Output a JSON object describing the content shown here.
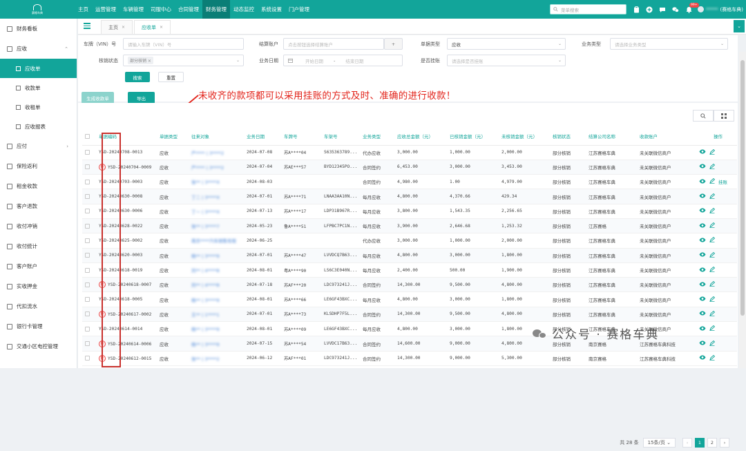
{
  "header": {
    "logo_text": "赛格车典",
    "nav": [
      "主页",
      "运营管理",
      "车辆管理",
      "司服中心",
      "合同管理",
      "财务管理",
      "动态监控",
      "系统设置",
      "门户管理"
    ],
    "active_nav": "财务管理",
    "search_placeholder": "菜单搜索",
    "notif_badge": "99+",
    "username": "(赛格车典)"
  },
  "sidebar": {
    "items": [
      {
        "label": "财务看板",
        "type": "item"
      },
      {
        "label": "应收",
        "type": "group",
        "expanded": true
      },
      {
        "label": "应收单",
        "type": "sub",
        "active": true
      },
      {
        "label": "收款单",
        "type": "sub"
      },
      {
        "label": "收租单",
        "type": "sub"
      },
      {
        "label": "应收报表",
        "type": "sub"
      },
      {
        "label": "应付",
        "type": "group",
        "expanded": false
      },
      {
        "label": "保险返利",
        "type": "item"
      },
      {
        "label": "租金收款",
        "type": "item"
      },
      {
        "label": "客户退款",
        "type": "item"
      },
      {
        "label": "收付冲销",
        "type": "item"
      },
      {
        "label": "收付统计",
        "type": "item"
      },
      {
        "label": "客户账户",
        "type": "item"
      },
      {
        "label": "实收押金",
        "type": "item"
      },
      {
        "label": "代扣流水",
        "type": "item"
      },
      {
        "label": "银行卡管理",
        "type": "item"
      },
      {
        "label": "交通小区电控管理",
        "type": "item"
      }
    ]
  },
  "tabs": [
    {
      "label": "主页",
      "close": "×"
    },
    {
      "label": "应收单",
      "close": "×",
      "active": true
    }
  ],
  "filters": {
    "vin_label": "车牌（VIN）号",
    "vin_placeholder": "请输入车牌（VIN）号",
    "account_label": "结算账户",
    "account_placeholder": "点击按钮选择结算账户",
    "account_btn": "+",
    "doc_type_label": "单据类型",
    "doc_type_value": "应收",
    "biz_type_label": "业务类型",
    "biz_type_placeholder": "请选择业务类型",
    "verify_label": "核销状态",
    "verify_chip": "部分核销",
    "biz_date_label": "业务日期",
    "start_placeholder": "开始日期",
    "date_sep": "-",
    "end_placeholder": "结束日期",
    "hang_label": "是否挂账",
    "hang_placeholder": "请选择是否挂账",
    "search_btn": "搜索",
    "reset_btn": "重置"
  },
  "toolbar": {
    "generate_btn": "生成收款单",
    "export_btn": "导出"
  },
  "annotation": "未收齐的款项都可以采用挂账的方式及时、准确的进行收款！",
  "table": {
    "columns": [
      "单据编码",
      "单据类型",
      "往来对象",
      "业务日期",
      "车牌号",
      "车架号",
      "业务类型",
      "应收总金额（元）",
      "已核销金额（元）",
      "未核销金额（元）",
      "核销状态",
      "结算公司名称",
      "收款账户",
      "操作"
    ],
    "rows": [
      {
        "gua": false,
        "code": "YSD-20240708-0013",
        "type": "应收",
        "party": "严**** | 3****2",
        "date": "2024-07-08",
        "plate": "苏A****04",
        "vin": "S635363789...",
        "biz": "代办应收",
        "total": "3,000.00",
        "done": "1,000.00",
        "undone": "2,000.00",
        "status": "部分核销",
        "company": "江苏赛格车典",
        "account": "未关联微信商户",
        "extra": ""
      },
      {
        "gua": true,
        "code": "YSD-20240704-0009",
        "type": "应收",
        "party": "严**** | 3****2",
        "date": "2024-07-04",
        "plate": "苏AE***57",
        "vin": "BYD12345PO...",
        "biz": "合同签约",
        "total": "6,453.00",
        "done": "3,000.00",
        "undone": "3,453.00",
        "status": "部分核销",
        "company": "江苏赛格车典",
        "account": "未关联微信商户",
        "extra": ""
      },
      {
        "gua": false,
        "code": "YSD-20240703-0003",
        "type": "应收",
        "party": "张** | 3****X",
        "date": "2024-08-03",
        "plate": "",
        "vin": "",
        "biz": "合同签约",
        "total": "4,980.00",
        "done": "1.00",
        "undone": "4,979.00",
        "status": "部分核销",
        "company": "江苏赛格车典",
        "account": "未关联微信商户",
        "extra": "挂账"
      },
      {
        "gua": false,
        "code": "YSD-20240630-0008",
        "type": "应收",
        "party": "丁二 | 3****X",
        "date": "2024-07-01",
        "plate": "苏A****71",
        "vin": "LNAA3AA10N...",
        "biz": "每月应收",
        "total": "4,800.00",
        "done": "4,370.66",
        "undone": "429.34",
        "status": "部分核销",
        "company": "江苏赛格车典",
        "account": "未关联微信商户",
        "extra": ""
      },
      {
        "gua": false,
        "code": "YSD-20240630-0006",
        "type": "应收",
        "party": "丁一 | 3****X",
        "date": "2024-07-13",
        "plate": "苏A****17",
        "vin": "LDP31B967R...",
        "biz": "每月应收",
        "total": "3,800.00",
        "done": "1,543.35",
        "undone": "2,256.65",
        "status": "部分核销",
        "company": "江苏赛格车典",
        "account": "未关联微信商户",
        "extra": ""
      },
      {
        "gua": false,
        "code": "YSD-20240628-0022",
        "type": "应收",
        "party": "张** | 3****7",
        "date": "2024-05-23",
        "plate": "鲁A****51",
        "vin": "LFPBC7PC1N...",
        "biz": "每月应收",
        "total": "3,900.00",
        "done": "2,646.68",
        "undone": "1,253.32",
        "status": "部分核销",
        "company": "江苏赛格",
        "account": "未关联微信商户",
        "extra": ""
      },
      {
        "gua": false,
        "code": "YSD-20240625-0002",
        "type": "应收",
        "party": "南京****汽车销售有限",
        "date": "2024-06-25",
        "plate": "",
        "vin": "",
        "biz": "代办应收",
        "total": "3,000.00",
        "done": "1,000.00",
        "undone": "2,000.00",
        "status": "部分核销",
        "company": "江苏赛格车典",
        "account": "未关联微信商户",
        "extra": ""
      },
      {
        "gua": false,
        "code": "YSD-20240620-0003",
        "type": "应收",
        "party": "杨** | 3****9",
        "date": "2024-07-01",
        "plate": "苏A****47",
        "vin": "LVVDCQ7B63...",
        "biz": "每月应收",
        "total": "4,800.00",
        "done": "3,000.00",
        "undone": "1,800.00",
        "status": "部分核销",
        "company": "江苏赛格车典",
        "account": "未关联微信商户",
        "extra": ""
      },
      {
        "gua": false,
        "code": "YSD-20240618-0019",
        "type": "应收",
        "party": "刘** | 4****8",
        "date": "2024-08-01",
        "plate": "粤A****90",
        "vin": "LS6C3E040N...",
        "biz": "每月应收",
        "total": "2,400.00",
        "done": "500.00",
        "undone": "1,900.00",
        "status": "部分核销",
        "company": "江苏赛格车典",
        "account": "未关联微信商户",
        "extra": ""
      },
      {
        "gua": true,
        "code": "YSD-20240618-0007",
        "type": "应收",
        "party": "刘** | 4****8",
        "date": "2024-07-18",
        "plate": "苏AF***20",
        "vin": "LDC973241J...",
        "biz": "合同签约",
        "total": "14,300.00",
        "done": "9,500.00",
        "undone": "4,800.00",
        "status": "部分核销",
        "company": "江苏赛格车典",
        "account": "未关联微信商户",
        "extra": ""
      },
      {
        "gua": false,
        "code": "YSD-20240618-0005",
        "type": "应收",
        "party": "杨** | 3****9",
        "date": "2024-08-01",
        "plate": "苏A****66",
        "vin": "LE6GF43BXC...",
        "biz": "每月应收",
        "total": "4,800.00",
        "done": "3,000.00",
        "undone": "1,800.00",
        "status": "部分核销",
        "company": "江苏赛格车典",
        "account": "未关联微信商户",
        "extra": ""
      },
      {
        "gua": true,
        "code": "YSD-20240617-0002",
        "type": "应收",
        "party": "王** | 1****1",
        "date": "2024-07-01",
        "plate": "苏A****73",
        "vin": "KLSDHP7F5L...",
        "biz": "合同签约",
        "total": "14,300.00",
        "done": "9,500.00",
        "undone": "4,800.00",
        "status": "部分核销",
        "company": "江苏赛格车典",
        "account": "未关联微信商户",
        "extra": ""
      },
      {
        "gua": false,
        "code": "YSD-20240614-0014",
        "type": "应收",
        "party": "杨** | 3****9",
        "date": "2024-08-01",
        "plate": "苏A****09",
        "vin": "LE6GF43BXC...",
        "biz": "每月应收",
        "total": "4,800.00",
        "done": "3,000.00",
        "undone": "1,800.00",
        "status": "部分核销",
        "company": "江苏赛格车典",
        "account": "未关联微信商户",
        "extra": ""
      },
      {
        "gua": true,
        "code": "YSD-20240614-0006",
        "type": "应收",
        "party": "杨** | 3****9",
        "date": "2024-07-15",
        "plate": "苏A****54",
        "vin": "LVVDC17B63...",
        "biz": "合同签约",
        "total": "14,600.00",
        "done": "9,000.00",
        "undone": "4,800.00",
        "status": "部分核销",
        "company": "南京赛格",
        "account": "江苏赛格车典科技",
        "extra": ""
      },
      {
        "gua": true,
        "code": "YSD-20240612-0015",
        "type": "应收",
        "party": "张** | 3****2",
        "date": "2024-06-12",
        "plate": "苏AF***01",
        "vin": "LDC973241J...",
        "biz": "合同签约",
        "total": "14,300.00",
        "done": "9,000.00",
        "undone": "5,300.00",
        "status": "部分核销",
        "company": "南京赛格",
        "account": "江苏赛格车典科技",
        "extra": ""
      }
    ]
  },
  "pagination": {
    "total_text": "共 28 条",
    "page_size": "15条/页",
    "prev": "‹",
    "pages": [
      "1",
      "2"
    ],
    "current": "1",
    "next": "›"
  },
  "watermark": "公众号 · 赛格车典",
  "colors": {
    "primary": "#12a59a",
    "annotation": "#e2231a",
    "link": "#4a86d8"
  }
}
